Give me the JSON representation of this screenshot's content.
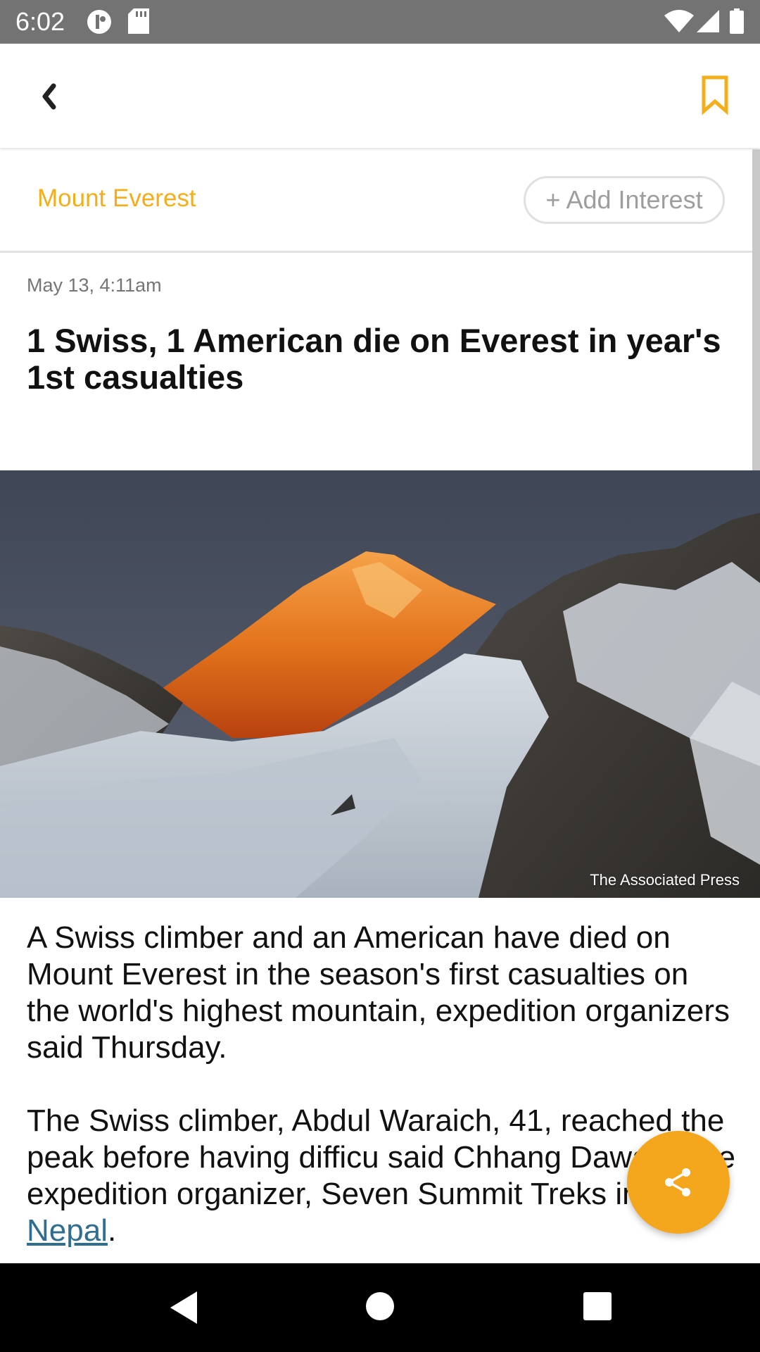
{
  "status_bar": {
    "time": "6:02",
    "icons": [
      "vpn-icon",
      "sd-card-icon",
      "wifi-icon",
      "signal-icon",
      "battery-icon"
    ]
  },
  "app_bar": {
    "back_icon": "back-icon",
    "bookmark_icon": "bookmark-icon",
    "accent_color": "#f2ae1b"
  },
  "interest_bar": {
    "topic": "Mount Everest",
    "add_interest": "+ Add Interest"
  },
  "article": {
    "date": "May 13, 4:11am",
    "title": "1 Swiss, 1 American die on Everest in year's 1st casualties",
    "image_credit": "The Associated Press",
    "paragraph_1": "A Swiss climber and an American have died on Mount Everest in the season's first casualties on the world's highest mountain, expedition organizers said Thursday.",
    "paragraph_2_before_link": "The Swiss climber, Abdul Waraich, 41, reached the peak before having difficu",
    "paragraph_2_line_3": "said Chhang Dawa of the expedition organizer, Seven Summit Treks in ",
    "link_text": "Nepal",
    "paragraph_2_after_link": "."
  },
  "fab": {
    "icon": "share-icon",
    "color": "#f4a61c"
  },
  "nav_bar": {
    "icons": [
      "nav-back-icon",
      "nav-home-icon",
      "nav-recents-icon"
    ]
  }
}
